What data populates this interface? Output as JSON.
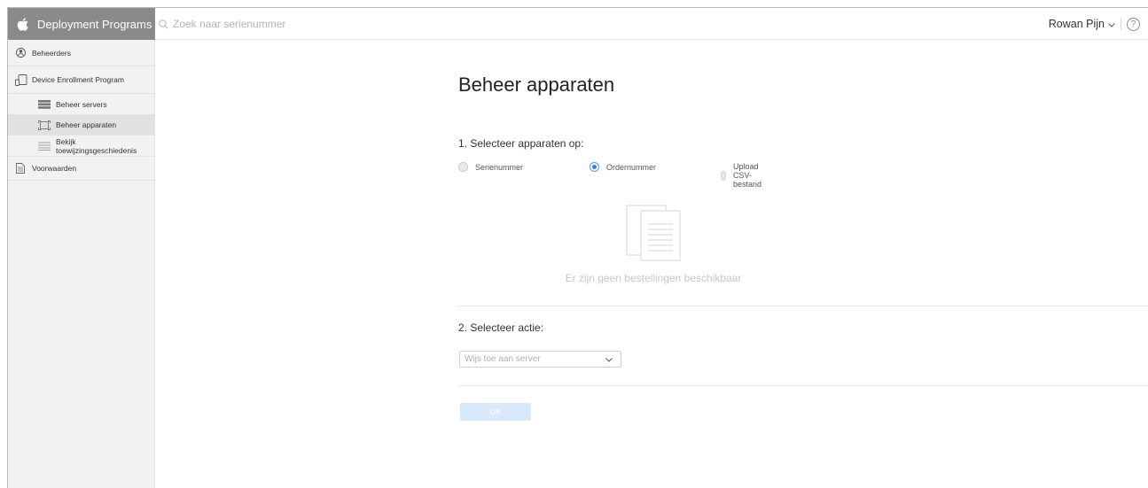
{
  "header": {
    "brand_title": "Deployment Programs",
    "search_placeholder": "Zoek naar serienummer",
    "user_name": "Rowan Pijn",
    "help_symbol": "?"
  },
  "sidebar": {
    "items": [
      {
        "label": "Beheerders",
        "icon": "person-circle-icon"
      },
      {
        "label": "Device Enrollment Program",
        "icon": "devices-icon"
      },
      {
        "label": "Beheer servers",
        "icon": "server-icon"
      },
      {
        "label": "Beheer apparaten",
        "icon": "device-frame-icon",
        "selected": true
      },
      {
        "label_line1": "Bekijk",
        "label_line2": "toewijzingsgeschiedenis",
        "icon": "list-icon"
      },
      {
        "label": "Voorwaarden",
        "icon": "document-icon"
      }
    ]
  },
  "main": {
    "title": "Beheer apparaten",
    "step1_label": "1. Selecteer apparaten op:",
    "radio_options": [
      {
        "label": "Serienummer",
        "checked": false
      },
      {
        "label": "Ordernummer",
        "checked": true
      },
      {
        "label": "Upload CSV-bestand",
        "checked": false
      }
    ],
    "empty_state_text": "Er zijn geen bestellingen beschikbaar",
    "step2_label": "2. Selecteer actie:",
    "action_select_value": "Wijs toe aan server",
    "ok_label": "OK"
  },
  "colors": {
    "brand_bg": "#8a8a8a",
    "sidebar_bg": "#f2f2f2",
    "selected_bg": "#e1e1e1",
    "radio_accent": "#2f7fe0",
    "ok_disabled_bg": "#d8e9fb"
  }
}
